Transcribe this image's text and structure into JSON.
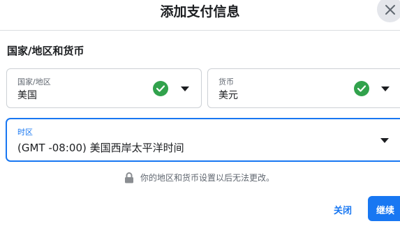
{
  "dialog": {
    "title": "添加支付信息",
    "close_icon": "close-icon"
  },
  "section": {
    "heading": "国家/地区和货币"
  },
  "country": {
    "label": "国家/地区",
    "value": "美国",
    "status_icon": "check-circle-icon",
    "status_color": "#31a24c"
  },
  "currency": {
    "label": "货币",
    "value": "美元",
    "status_icon": "check-circle-icon",
    "status_color": "#31a24c"
  },
  "timezone": {
    "label": "时区",
    "value": "(GMT -08:00) 美国西岸太平洋时间",
    "focus_color": "#1877f2"
  },
  "note": {
    "icon": "lock-icon",
    "text": "你的地区和货币设置以后无法更改。"
  },
  "footer": {
    "close_label": "关闭",
    "continue_label": "继续",
    "accent_color": "#1877f2"
  }
}
